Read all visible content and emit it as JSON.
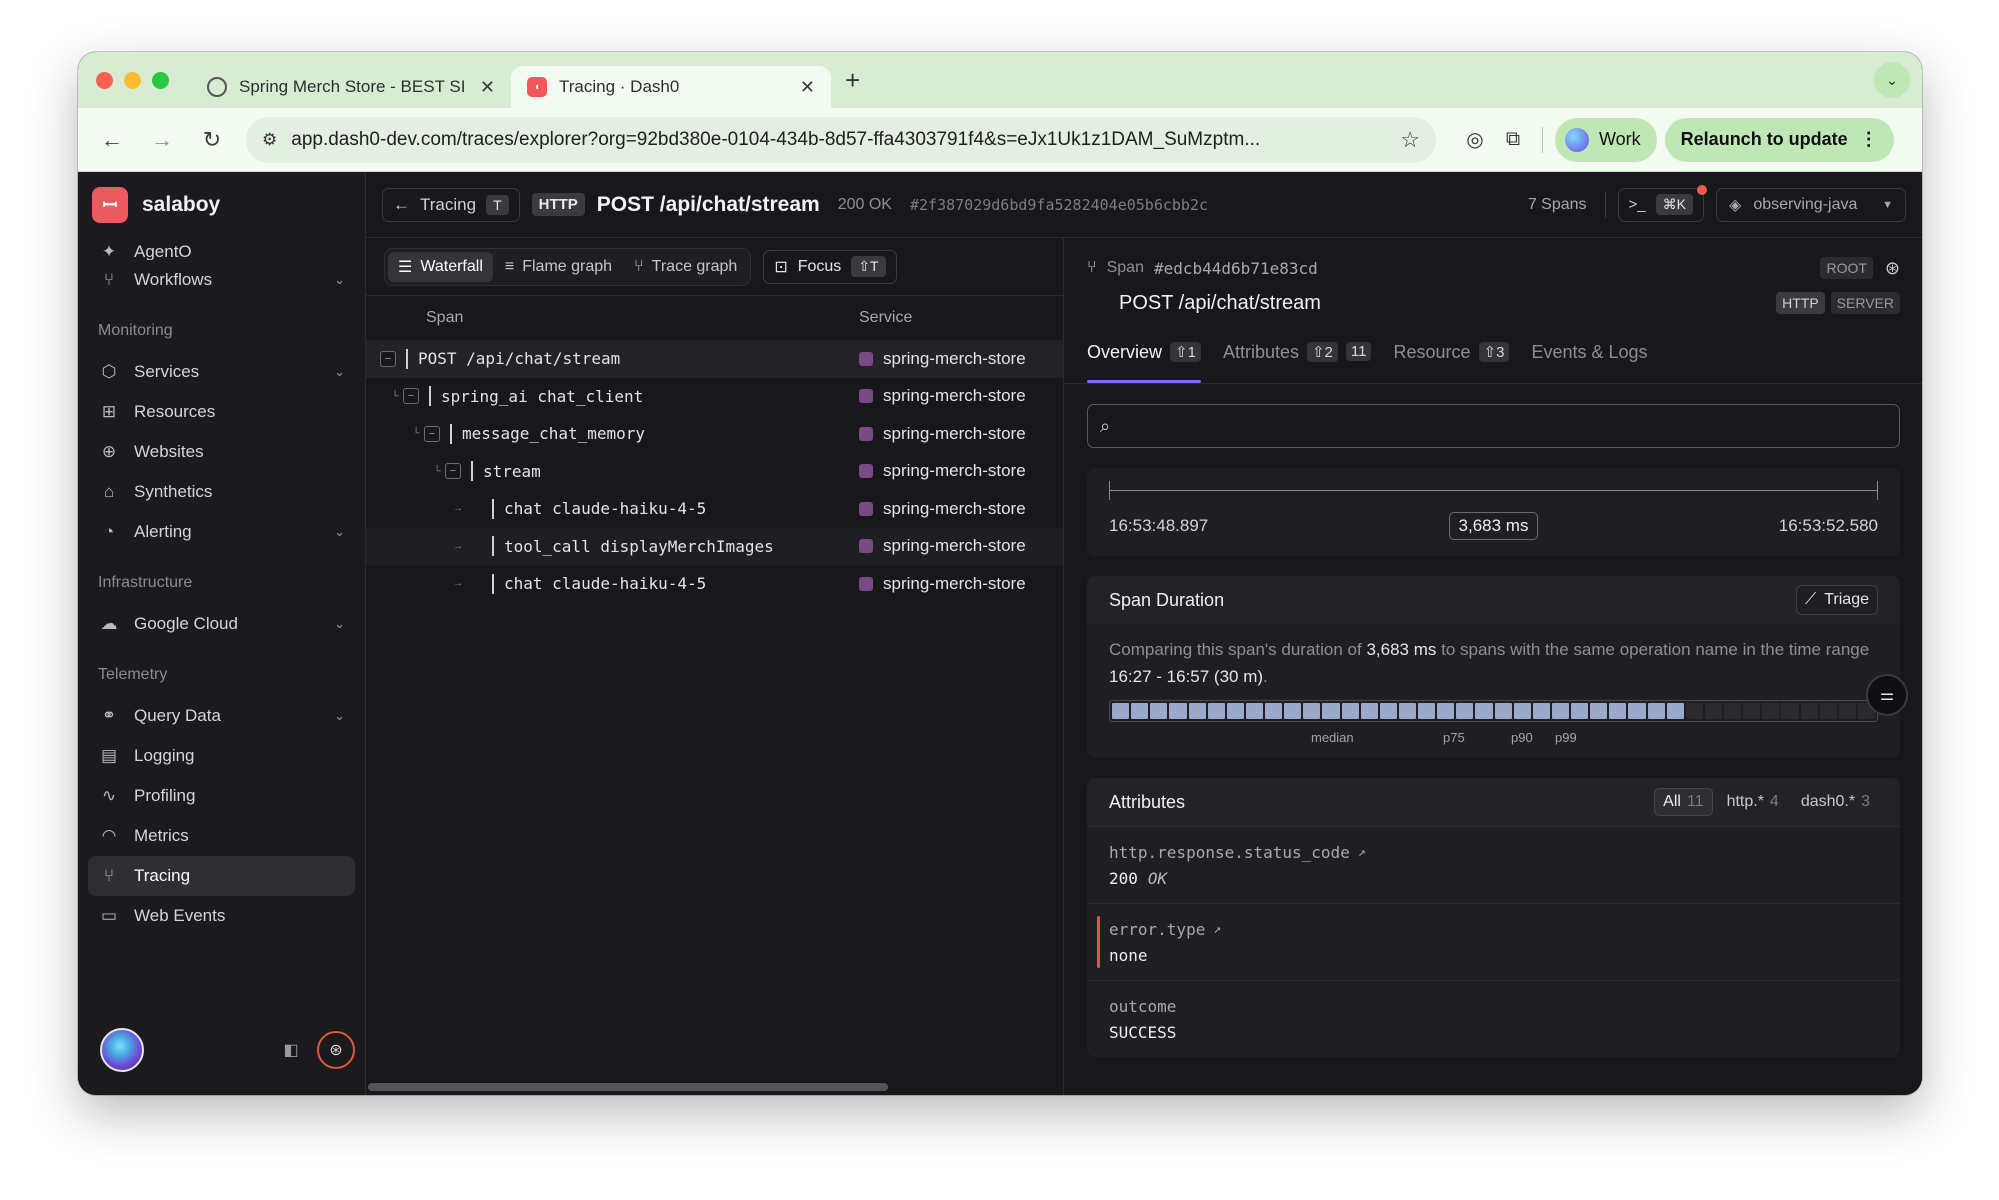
{
  "browser": {
    "tabs": [
      {
        "title": "Spring Merch Store - BEST SI",
        "active": false
      },
      {
        "title": "Tracing · Dash0",
        "active": true
      }
    ],
    "url": "app.dash0-dev.com/traces/explorer?org=92bd380e-0104-434b-8d57-ffa4303791f4&s=eJx1Uk1z1DAM_SuMzptm...",
    "profile_label": "Work",
    "relaunch_label": "Relaunch to update"
  },
  "sidebar": {
    "org_name": "salaboy",
    "top_items": [
      {
        "label": "AgentO",
        "icon": "agent-icon"
      },
      {
        "label": "Workflows",
        "icon": "workflow-icon",
        "chevron": true
      }
    ],
    "sections": [
      {
        "title": "Monitoring",
        "items": [
          {
            "label": "Services",
            "icon": "cube-icon",
            "chevron": true
          },
          {
            "label": "Resources",
            "icon": "resources-icon"
          },
          {
            "label": "Websites",
            "icon": "globe-icon"
          },
          {
            "label": "Synthetics",
            "icon": "robot-icon"
          },
          {
            "label": "Alerting",
            "icon": "bell-icon",
            "chevron": true
          }
        ]
      },
      {
        "title": "Infrastructure",
        "items": [
          {
            "label": "Google Cloud",
            "icon": "cloud-icon",
            "chevron": true
          }
        ]
      },
      {
        "title": "Telemetry",
        "items": [
          {
            "label": "Query Data",
            "icon": "binoculars-icon",
            "chevron": true
          },
          {
            "label": "Logging",
            "icon": "document-icon"
          },
          {
            "label": "Profiling",
            "icon": "pulse-icon"
          },
          {
            "label": "Metrics",
            "icon": "gauge-icon"
          },
          {
            "label": "Tracing",
            "icon": "tracing-icon",
            "active": true
          },
          {
            "label": "Web Events",
            "icon": "browser-icon"
          }
        ]
      }
    ]
  },
  "header": {
    "back_label": "Tracing",
    "back_kbd": "T",
    "method_badge": "HTTP",
    "title": "POST /api/chat/stream",
    "status": "200 OK",
    "trace_id": "#2f387029d6bd9fa5282404e05b6cbb2c",
    "spans_count": "7 Spans",
    "cmd_kbd": "⌘K",
    "dataset": "observing-java"
  },
  "waterfall": {
    "view_tabs": [
      "Waterfall",
      "Flame graph",
      "Trace graph"
    ],
    "focus_label": "Focus",
    "focus_kbd": "⇧T",
    "col_span": "Span",
    "col_service": "Service",
    "rows": [
      {
        "name": "POST /api/chat/stream",
        "service": "spring-merch-store",
        "depth": 0,
        "toggle": true
      },
      {
        "name": "spring_ai chat_client",
        "service": "spring-merch-store",
        "depth": 1,
        "toggle": true
      },
      {
        "name": "message_chat_memory",
        "service": "spring-merch-store",
        "depth": 2,
        "toggle": true
      },
      {
        "name": "stream",
        "service": "spring-merch-store",
        "depth": 3,
        "toggle": true
      },
      {
        "name": "chat claude-haiku-4-5",
        "service": "spring-merch-store",
        "depth": 4,
        "toggle": false
      },
      {
        "name": "tool_call displayMerchImages",
        "service": "spring-merch-store",
        "depth": 4,
        "toggle": false
      },
      {
        "name": "chat claude-haiku-4-5",
        "service": "spring-merch-store",
        "depth": 4,
        "toggle": false
      }
    ],
    "service_color": "#7a4a86"
  },
  "detail": {
    "span_label": "Span",
    "span_id": "#edcb44d6b71e83cd",
    "root_tag": "ROOT",
    "title": "POST /api/chat/stream",
    "tags": [
      "HTTP",
      "SERVER"
    ],
    "tabs": [
      {
        "label": "Overview",
        "count": "⇧1",
        "active": true
      },
      {
        "label": "Attributes",
        "count": "⇧2",
        "extra": "11"
      },
      {
        "label": "Resource",
        "count": "⇧3"
      },
      {
        "label": "Events & Logs"
      }
    ],
    "search_placeholder": "",
    "timeline": {
      "start": "16:53:48.897",
      "end": "16:53:52.580",
      "duration": "3,683 ms"
    },
    "span_duration": {
      "title": "Span Duration",
      "triage_label": "Triage",
      "text_a": "Comparing this span's duration of ",
      "duration": "3,683 ms",
      "text_b": " to spans with the same operation name in the time range ",
      "range": "16:27 - 16:57 (30 m)",
      "text_c": ".",
      "percentile_labels": [
        "median",
        "p75",
        "p90",
        "p99"
      ],
      "filled_fraction": 0.75
    },
    "attributes": {
      "title": "Attributes",
      "filters": [
        {
          "label": "All",
          "count": "11",
          "active": true
        },
        {
          "label": "http.*",
          "count": "4"
        },
        {
          "label": "dash0.*",
          "count": "3"
        }
      ],
      "items": [
        {
          "key": "http.response.status_code",
          "value": "200",
          "note": "OK",
          "link": true
        },
        {
          "key": "error.type",
          "value": "none",
          "link": true,
          "error": true
        },
        {
          "key": "outcome",
          "value": "SUCCESS"
        }
      ]
    }
  }
}
